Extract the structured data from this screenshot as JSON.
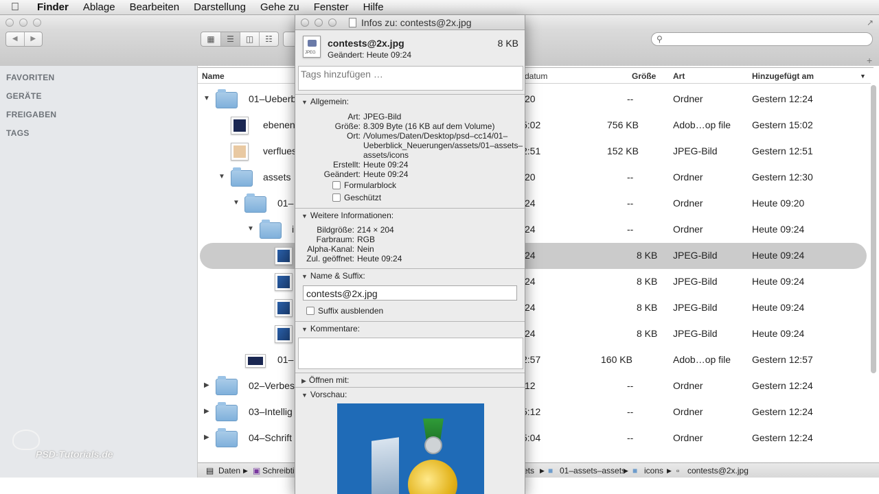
{
  "menubar": {
    "items": [
      "Finder",
      "Ablage",
      "Bearbeiten",
      "Darstellung",
      "Gehe zu",
      "Fenster",
      "Hilfe"
    ]
  },
  "sidebar": {
    "sections": [
      "FAVORITEN",
      "GERÄTE",
      "FREIGABEN",
      "TAGS"
    ]
  },
  "list": {
    "columns": {
      "name": "Name",
      "date": "datum",
      "size": "Größe",
      "kind": "Art",
      "added": "Hinzugefügt am"
    },
    "rows": [
      {
        "name": "01–Ueberb",
        "date": "20",
        "size": "--",
        "kind": "Ordner",
        "added": "Gestern 12:24"
      },
      {
        "name": "ebenen",
        "date": "5:02",
        "size": "756 KB",
        "kind": "Adob…op file",
        "added": "Gestern 15:02"
      },
      {
        "name": "verflues",
        "date": "2:51",
        "size": "152 KB",
        "kind": "JPEG-Bild",
        "added": "Gestern 12:51"
      },
      {
        "name": "assets",
        "date": "20",
        "size": "--",
        "kind": "Ordner",
        "added": "Gestern 12:30"
      },
      {
        "name": "01–",
        "date": "24",
        "size": "--",
        "kind": "Ordner",
        "added": "Heute 09:20"
      },
      {
        "name": "i",
        "date": "24",
        "size": "--",
        "kind": "Ordner",
        "added": "Heute 09:24"
      },
      {
        "name": "",
        "date": "24",
        "size": "8 KB",
        "kind": "JPEG-Bild",
        "added": "Heute 09:24"
      },
      {
        "name": "",
        "date": "24",
        "size": "8 KB",
        "kind": "JPEG-Bild",
        "added": "Heute 09:24"
      },
      {
        "name": "",
        "date": "24",
        "size": "8 KB",
        "kind": "JPEG-Bild",
        "added": "Heute 09:24"
      },
      {
        "name": "",
        "date": "24",
        "size": "8 KB",
        "kind": "JPEG-Bild",
        "added": "Heute 09:24"
      },
      {
        "name": "01–",
        "date": "2:57",
        "size": "160 KB",
        "kind": "Adob…op file",
        "added": "Gestern 12:57"
      },
      {
        "name": "02–Verbes",
        "date": "12",
        "size": "--",
        "kind": "Ordner",
        "added": "Gestern 12:24"
      },
      {
        "name": "03–Intellig",
        "date": "5:12",
        "size": "--",
        "kind": "Ordner",
        "added": "Gestern 12:24"
      },
      {
        "name": "04–Schrift",
        "date": "5:04",
        "size": "--",
        "kind": "Ordner",
        "added": "Gestern 12:24"
      }
    ]
  },
  "pathbar": {
    "items": [
      "Daten",
      "Schreibti",
      "ets",
      "01–assets–assets",
      "icons",
      "contests@2x.jpg"
    ]
  },
  "watermark": {
    "text": "PSD-Tutorials.de"
  },
  "info": {
    "window_title": "Infos zu: contests@2x.jpg",
    "file_name": "contests@2x.jpg",
    "file_size": "8 KB",
    "modified": "Geändert: Heute 09:24",
    "doc_label": "JPEG",
    "tags_placeholder": "Tags hinzufügen …",
    "general": {
      "header": "Allgemein:",
      "keys": [
        "Art:",
        "Größe:",
        "Ort:",
        "Erstellt:",
        "Geändert:"
      ],
      "kind": "JPEG-Bild",
      "size": "8.309 Byte (16 KB auf dem Volume)",
      "location_lines": [
        "/Volumes/Daten/Desktop/psd–cc14/01–",
        "Ueberblick_Neuerungen/assets/01–assets–",
        "assets/icons"
      ],
      "created": "Heute 09:24",
      "modified": "Heute 09:24",
      "stationery": "Formularblock",
      "locked": "Geschützt"
    },
    "more": {
      "header": "Weitere Informationen:",
      "keys": [
        "Bildgröße:",
        "Farbraum:",
        "Alpha-Kanal:",
        "Zul. geöffnet:"
      ],
      "dimensions": "214 × 204",
      "colorspace": "RGB",
      "alpha": "Nein",
      "last_opened": "Heute 09:24"
    },
    "name_ext": {
      "header": "Name & Suffix:",
      "value": "contests@2x.jpg",
      "hide_ext": "Suffix ausblenden"
    },
    "comments": {
      "header": "Kommentare:"
    },
    "open_with": {
      "header": "Öffnen mit:"
    },
    "preview": {
      "header": "Vorschau:"
    }
  },
  "icons": {
    "apple": "apple-logo-icon",
    "back": "chevron-left-icon",
    "forward": "chevron-right-icon",
    "search": "magnifier-icon",
    "doc": "document-icon"
  },
  "colors": {
    "selection": "#cbcbcb",
    "folder": "#8fbbe1",
    "preview_bg": "#1f6bb7"
  }
}
